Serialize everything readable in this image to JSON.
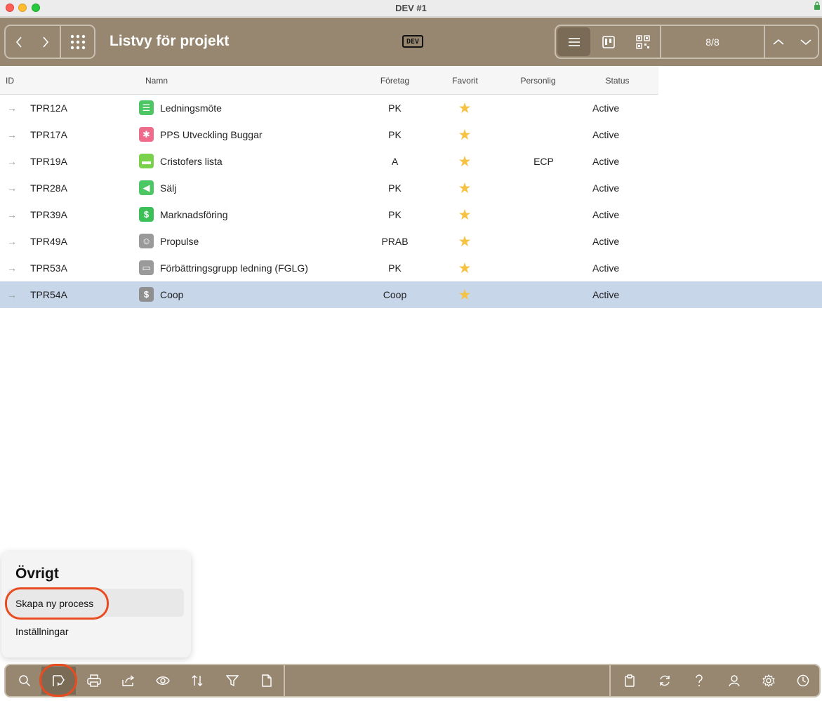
{
  "window": {
    "title": "DEV #1"
  },
  "header": {
    "title": "Listvy för projekt",
    "dev_badge": "DEV",
    "record_counter": "8/8"
  },
  "table": {
    "columns": [
      "ID",
      "Namn",
      "Företag",
      "Favorit",
      "Personlig",
      "Status"
    ],
    "rows": [
      {
        "id": "TPR12A",
        "name": "Ledningsmöte",
        "company": "PK",
        "favorite": true,
        "personal": "",
        "status": "Active",
        "icon": "signpost-icon",
        "icon_color": "#4cc764"
      },
      {
        "id": "TPR17A",
        "name": "PPS Utveckling Buggar",
        "company": "PK",
        "favorite": true,
        "personal": "",
        "status": "Active",
        "icon": "bug-icon",
        "icon_color": "#ee6b8c"
      },
      {
        "id": "TPR19A",
        "name": "Cristofers lista",
        "company": "A",
        "favorite": true,
        "personal": "ECP",
        "status": "Active",
        "icon": "car-icon",
        "icon_color": "#7ad14a"
      },
      {
        "id": "TPR28A",
        "name": "Sälj",
        "company": "PK",
        "favorite": true,
        "personal": "",
        "status": "Active",
        "icon": "megaphone-icon",
        "icon_color": "#4cc764"
      },
      {
        "id": "TPR39A",
        "name": "Marknadsföring",
        "company": "PK",
        "favorite": true,
        "personal": "",
        "status": "Active",
        "icon": "dollar-icon",
        "icon_color": "#3cbf56"
      },
      {
        "id": "TPR49A",
        "name": "Propulse",
        "company": "PRAB",
        "favorite": true,
        "personal": "",
        "status": "Active",
        "icon": "smiley-icon",
        "icon_color": "#9a9a9a"
      },
      {
        "id": "TPR53A",
        "name": "Förbättringsgrupp ledning (FGLG)",
        "company": "PK",
        "favorite": true,
        "personal": "",
        "status": "Active",
        "icon": "monitor-icon",
        "icon_color": "#9a9a9a"
      },
      {
        "id": "TPR54A",
        "name": "Coop",
        "company": "Coop",
        "favorite": true,
        "personal": "",
        "status": "Active",
        "icon": "dollar-icon",
        "icon_color": "#8f8f8f"
      }
    ]
  },
  "popover": {
    "title": "Övrigt",
    "items": [
      "Skapa ny process",
      "Inställningar"
    ]
  },
  "toolbar_left": [
    "search-icon",
    "process-flag-icon",
    "print-icon",
    "share-icon",
    "eye-icon",
    "sort-icon",
    "filter-icon",
    "document-icon"
  ],
  "toolbar_right": [
    "clipboard-icon",
    "refresh-icon",
    "help-icon",
    "user-icon",
    "gear-icon",
    "clock-icon"
  ],
  "colors": {
    "toolbar_bg": "#978770",
    "selected_row": "#c7d6e9",
    "highlight_ring": "#e74b1f",
    "star": "#f5c242"
  }
}
